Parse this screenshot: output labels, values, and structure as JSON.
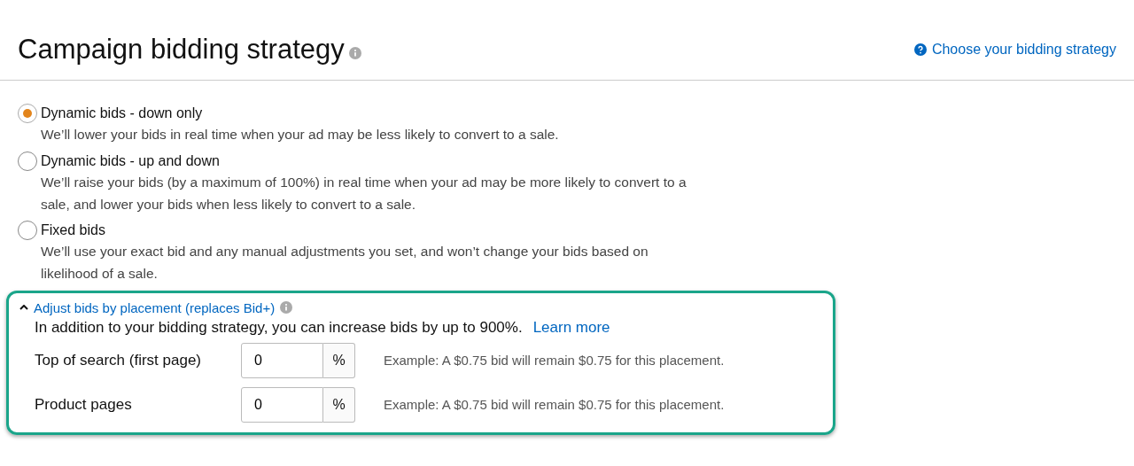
{
  "header": {
    "title": "Campaign bidding strategy",
    "help_link": "Choose your bidding strategy"
  },
  "strategies": [
    {
      "label": "Dynamic bids - down only",
      "description": "We’ll lower your bids in real time when your ad may be less likely to convert to a sale.",
      "selected": true
    },
    {
      "label": "Dynamic bids - up and down",
      "description": "We’ll raise your bids (by a maximum of 100%) in real time when your ad may be more likely to convert to a sale, and lower your bids when less likely to convert to a sale.",
      "selected": false
    },
    {
      "label": "Fixed bids",
      "description": "We’ll use your exact bid and any manual adjustments you set, and won’t change your bids based on likelihood of a sale.",
      "selected": false
    }
  ],
  "placement": {
    "title": "Adjust bids by placement (replaces Bid+)",
    "expanded": true,
    "intro": "In addition to your bidding strategy, you can increase bids by up to 900%.",
    "learn_more": "Learn more",
    "rows": [
      {
        "label": "Top of search (first page)",
        "value": "0",
        "unit": "%",
        "example": "Example: A $0.75 bid will remain $0.75 for this placement."
      },
      {
        "label": "Product pages",
        "value": "0",
        "unit": "%",
        "example": "Example: A $0.75 bid will remain $0.75 for this placement."
      }
    ]
  }
}
